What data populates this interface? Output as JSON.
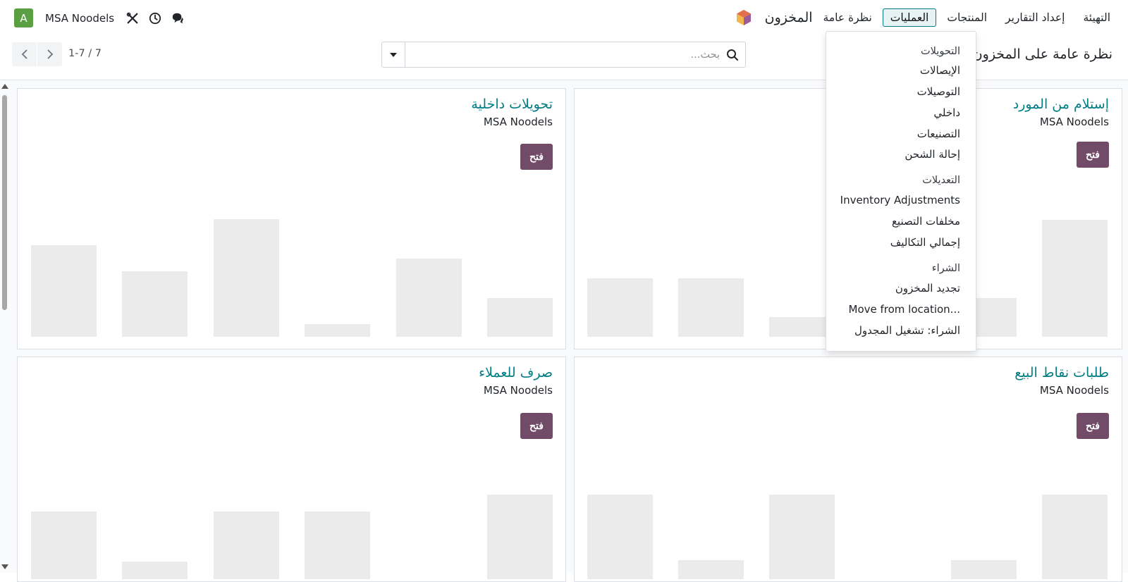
{
  "navbar": {
    "app_name": "المخزون",
    "menu": [
      "نظرة عامة",
      "العمليات",
      "المنتجات",
      "إعداد التقارير",
      "التهيئة"
    ],
    "active_menu": "العمليات",
    "company": "MSA Noodels",
    "avatar_letter": "A",
    "icons": [
      "chat-icon",
      "clock-icon",
      "tools-icon"
    ]
  },
  "control": {
    "breadcrumb": "نظرة عامة على المخزون",
    "search_placeholder": "بحث...",
    "pager": "1-7 / 7"
  },
  "cards": [
    {
      "title": "إستلام من المورد",
      "company": "MSA Noodels",
      "button": "فتح"
    },
    {
      "title": "تحويلات داخلية",
      "company": "MSA Noodels",
      "button": "فتح"
    },
    {
      "title": "طلبات نقاط البيع",
      "company": "MSA Noodels",
      "button": "فتح"
    },
    {
      "title": "صرف للعملاء",
      "company": "MSA Noodels",
      "button": "فتح"
    }
  ],
  "dropdown": {
    "sections": [
      {
        "header": "التحويلات",
        "items": [
          "الإيصالات",
          "التوصيلات",
          "داخلي",
          "التصنيعات",
          "إحالة الشحن"
        ]
      },
      {
        "header": "التعديلات",
        "items": [
          "Inventory Adjustments",
          "مخلفات التصنيع",
          "إجمالي التكاليف"
        ]
      },
      {
        "header": "الشراء",
        "items": [
          "تجديد المخزون",
          "Move from location...",
          "الشراء: تشغيل المجدول"
        ]
      }
    ]
  },
  "colors": {
    "brand": "#714b67",
    "accent": "#017e84",
    "avatar": "#5aa043",
    "placeholder_bar": "#ebebeb"
  }
}
